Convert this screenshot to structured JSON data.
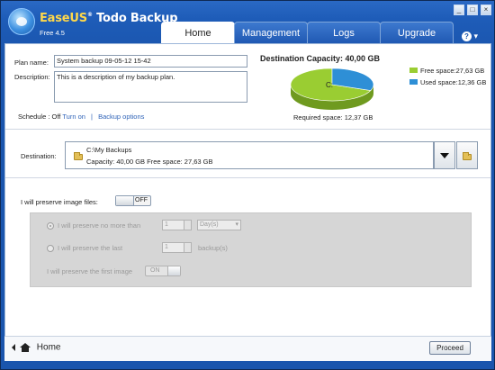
{
  "app": {
    "brand_prefix": "EaseUS",
    "brand_suffix": "Todo Backup",
    "edition": "Free 4.5"
  },
  "window_controls": {
    "minimize": "_",
    "maximize": "□",
    "close": "×"
  },
  "tabs": [
    {
      "label": "Home",
      "active": true
    },
    {
      "label": "Management",
      "active": false
    },
    {
      "label": "Logs",
      "active": false
    },
    {
      "label": "Upgrade",
      "active": false
    }
  ],
  "help": {
    "glyph": "?",
    "arrow": "▾"
  },
  "plan": {
    "name_label": "Plan name:",
    "name_value": "System backup 09-05-12 15-42",
    "description_label": "Description:",
    "description_value": "This is a description of my backup plan.",
    "schedule_label": "Schedule : Off",
    "turn_on": "Turn on",
    "separator": "|",
    "backup_options": "Backup options"
  },
  "capacity": {
    "title": "Destination Capacity: 40,00 GB",
    "pie_label": "C:",
    "free_label": "Free space:27,63 GB",
    "used_label": "Used space:12,36 GB",
    "free_fraction": 0.691,
    "used_fraction": 0.309,
    "free_color": "#9acd32",
    "used_color": "#2e8fd6",
    "required": "Required space: 12,37 GB"
  },
  "destination": {
    "label": "Destination:",
    "path": "C:\\My Backups",
    "capacity_text": "Capacity: 40,00 GB   Free space: 27,63 GB"
  },
  "preserve": {
    "label": "I will preserve image files:",
    "toggle_state": "OFF",
    "option1_label": "I will preserve no more than",
    "option1_value": "1",
    "option1_unit": "Day(s)",
    "option2_label": "I will preserve the last",
    "option2_value": "1",
    "option2_unit": "backup(s)",
    "option3_label": "I will preserve the first image",
    "option3_toggle": "ON"
  },
  "footer": {
    "home_label": "Home",
    "proceed_label": "Proceed"
  }
}
